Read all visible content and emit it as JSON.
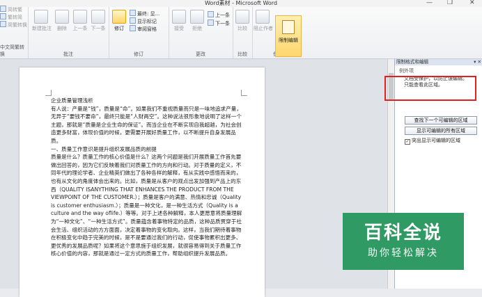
{
  "window": {
    "title": "Word素材 - Microsoft Word",
    "minimize": "—",
    "restore": "❐",
    "close": "✕"
  },
  "ribbon": {
    "left_group": {
      "items": [
        "简转繁",
        "繁转简",
        "简繁转换"
      ],
      "label": "中文简繁转换"
    },
    "comments": {
      "label": "批注",
      "new": "新建批注",
      "delete": "删除",
      "prev": "上一条",
      "next": "下一条"
    },
    "tracking": {
      "label": "修订",
      "track": "修订",
      "markup_final": "最终: 显...",
      "show_markup": "显示标记",
      "review_pane": "审阅窗格"
    },
    "changes": {
      "label": "更改",
      "accept": "接受",
      "reject": "拒绝",
      "prev": "上一条",
      "next": "下一条"
    },
    "compare": {
      "label": "比较",
      "compare": "比较"
    },
    "protect": {
      "label": "保护",
      "block_authors": "阻止作者",
      "restrict_editing": "限制编辑"
    }
  },
  "document": {
    "paragraphs": [
      "企业质量管理浅析",
      "有人说：产量是“钱”，质量是“命”。如果我们不重视质量而只是一味地追求产量，无异于“要钱不要命”，最终只能是“人财两空”。这种说法很形象地说明了这样一个主题，那就是“质量是企业生命的保证”。而当企业在不断实现自我超越，为社会创造更多财富，体现价值的时候，更需要开展好质量工作，以不断提升自身发展品质。",
      "一、质量工作意识是提升组织发展品质的前提",
      "质量是什么？质量工作的核心价值是什么？这两个问题是我们开展质量工作首先要做出回答的，因为它们反映着我们对质量工作的方向和行动。对于质量的定义，不同年代的理论学者、企业精英们做出了各种各样的解释，有从实践中感悟而来的，也有从文化的角度体会出来的。比如，质量是从客户的观点出发加强到产品上的东西（QUALITY ISANYTHING THAT ENHANCES THE PRODUCT FROM THE VIEWPOINT OF THE CUSTOMER.）；质量是客户的满意、热情和忠诚（Quality is customer enthusiasm.）；质量是一种文化，是一种生活方式（Quality is a culture and the way oflife.）等等。对于上述各种解释，本人更愿意将质量理解为“一种文化”、“一种生活方式”。质量蕴含着事物特定的品质，这种品质贯穿于社会生活、组织活动的方方面面，决定着事物的变化取向。这样，当我们期待着事物在积极变化中趋于完美的时候，是不是要通过我们的行动，促使事物累积出更多、更优秀的发展品质呢？如果将这个意思施于组织发展，就很容易得到关于质量工作核心价值的内容，那就是通过一定方式的质量工作，帮助组织提升发展品质。"
    ]
  },
  "task_pane": {
    "title": "限制格式和编辑",
    "exceptions_label": "例外项",
    "message": [
      "文档受保护，以防止误编辑。",
      "只能查看此区域。"
    ],
    "find_next_button": "查找下一个可编辑的区域",
    "show_all_button": "显示可编辑的所有区域",
    "highlight_checkbox": "突出显示可编辑的区域",
    "highlight_checked": true
  },
  "watermark": {
    "line1": "百科全说",
    "line2": "助你轻松解决"
  },
  "colors": {
    "highlight_border": "#e02020",
    "watermark_bg": "#2f9a63",
    "active_button": "#ffd66e"
  }
}
